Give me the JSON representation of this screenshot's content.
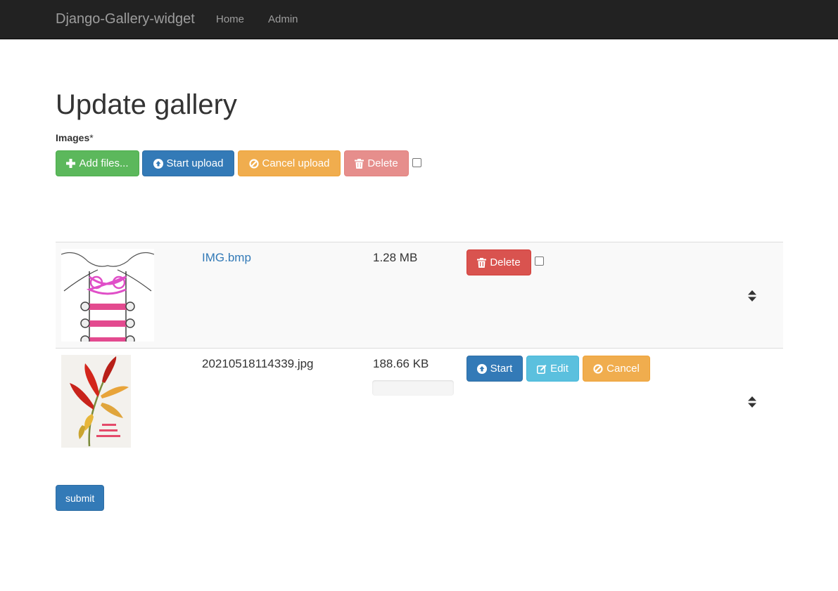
{
  "navbar": {
    "brand": "Django-Gallery-widget",
    "links": [
      {
        "label": "Home"
      },
      {
        "label": "Admin"
      }
    ]
  },
  "page": {
    "title": "Update gallery",
    "field_label": "Images",
    "required_mark": "*"
  },
  "toolbar": {
    "add_label": "Add files...",
    "start_label": "Start upload",
    "cancel_label": "Cancel upload",
    "delete_label": "Delete",
    "select_all_checked": false
  },
  "files": [
    {
      "name": "IMG.bmp",
      "size": "1.28 MB",
      "status": "uploaded",
      "thumbnail": "shoelace drawing",
      "actions": [
        {
          "label": "Delete",
          "icon": "trash-icon",
          "color": "#d9534f"
        }
      ],
      "checked": false
    },
    {
      "name": "20210518114339.jpg",
      "size": "188.66 KB",
      "status": "pending",
      "progress": 0,
      "thumbnail": "flower painting",
      "actions": [
        {
          "label": "Start",
          "icon": "upload-icon",
          "color": "#337ab7"
        },
        {
          "label": "Edit",
          "icon": "edit-icon",
          "color": "#5bc0de"
        },
        {
          "label": "Cancel",
          "icon": "ban-icon",
          "color": "#f0ad4e"
        }
      ]
    }
  ],
  "form": {
    "submit_label": "submit"
  },
  "colors": {
    "navbar_bg": "#222222",
    "success": "#5cb85c",
    "primary": "#337ab7",
    "warning": "#f0ad4e",
    "danger": "#d9534f",
    "info": "#5bc0de"
  }
}
